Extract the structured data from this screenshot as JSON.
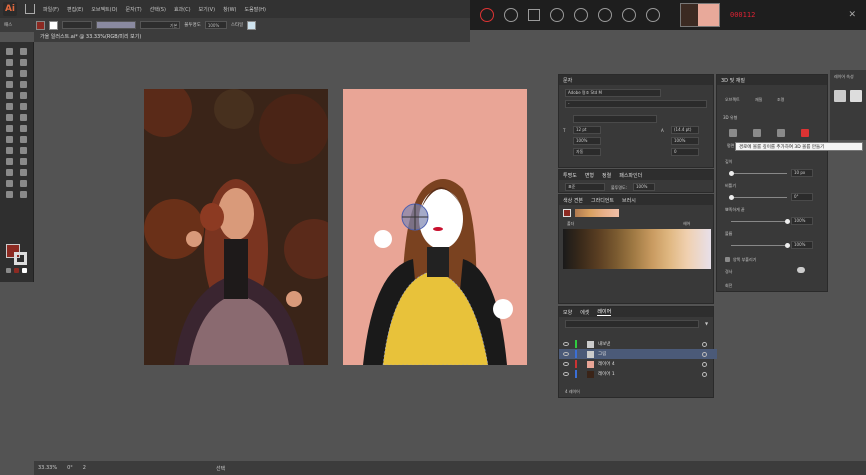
{
  "menubar": {
    "logo": "Ai",
    "items": [
      "파일(F)",
      "편집(E)",
      "오브젝트(O)",
      "문자(T)",
      "선택(S)",
      "효과(C)",
      "보기(V)",
      "창(W)",
      "도움말(H)"
    ]
  },
  "recorder": {
    "timer": "000112",
    "close": "✕"
  },
  "control_bar": {
    "left_label": "패스",
    "stroke_style": "기본",
    "opacity_label": "불투명도",
    "opacity_value": "100%",
    "style_label": "스타일"
  },
  "document_tab": "가을 일러스트.ai* @ 33.33%(RGB/미리 보기)",
  "status_bar": {
    "zoom": "33.33%",
    "angle": "0°",
    "artboard": "2",
    "tool": "선택"
  },
  "character_panel": {
    "title": "문자",
    "font": "Adobe 명조 Std M",
    "style": "-",
    "size": "12 pt",
    "leading": "(14.4 pt)",
    "vscale": "100%",
    "hscale": "100%",
    "kerning": "자동",
    "tracking": "0",
    "baseline": "0 pt",
    "rotate": "0°",
    "percent1": "100%",
    "percent2": "100%"
  },
  "transparency_panel": {
    "tabs": [
      "투명도",
      "변형",
      "정렬",
      "패스파인더"
    ],
    "mode": "표준",
    "opacity_label": "불투명도:",
    "opacity": "100%"
  },
  "swatch_panel": {
    "tabs": [
      "색상 견본",
      "그라디언트",
      "브러시"
    ],
    "group_label": "폴더",
    "group2_label": "헤어"
  },
  "layers_panel": {
    "tabs": [
      "모양",
      "에셋",
      "레이어"
    ],
    "layers": [
      {
        "name": "내보낸",
        "color": "#2ecc40"
      },
      {
        "name": "그림",
        "color": "#3b6fd6"
      },
      {
        "name": "레이어 4",
        "color": "#cc3333"
      },
      {
        "name": "레이어 1",
        "color": "#3b6fd6"
      }
    ],
    "footer": "4 레이어"
  },
  "three_d_panel": {
    "title": "3D 및 재질",
    "tabs": [
      "오브젝트",
      "재질",
      "조명"
    ],
    "type_label": "3D 유형",
    "plane_label": "평면",
    "depth_label": "깊이",
    "depth_value": "10 px",
    "twist_label": "비틀기",
    "twist_value": "0°",
    "taper_label": "뾰족하게 끝",
    "taper_value": "100%",
    "volume_label": "볼륨",
    "volume_value": "100%",
    "cap_label": "양쪽 부풀리기",
    "bevel_label": "경사",
    "rotation_label": "회전"
  },
  "tooltip": "경로에 볼륨 깊이를 추가하여 3D 볼륨 만들기",
  "right_panel_tab": "레이어 속성",
  "colors": {
    "fill": "#8c2a22",
    "artboard_bg": "#e9a596",
    "accent_blue": "#4b5a78"
  }
}
